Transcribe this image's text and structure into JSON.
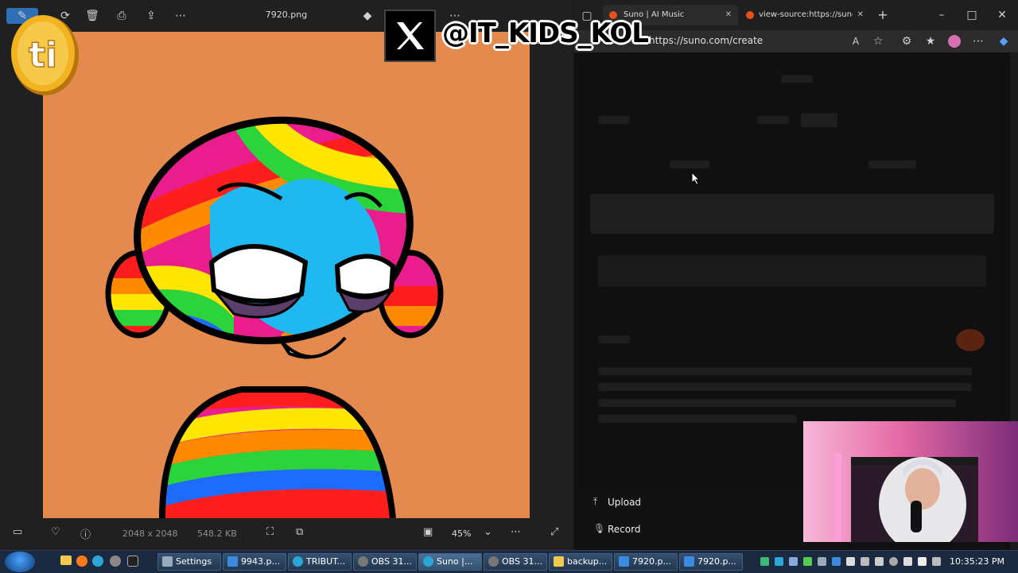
{
  "photos": {
    "title": "7920.png",
    "dimensions": "2048 x 2048",
    "filesize": "548.2 KB",
    "zoom": "45%"
  },
  "browser": {
    "tabs": [
      {
        "label": "Suno | AI Music"
      },
      {
        "label": "view-source:https://suno.c"
      }
    ],
    "url": "https://suno.com/create",
    "menu": {
      "upload": "Upload",
      "record": "Record"
    }
  },
  "overlay": {
    "handle": "@IT_KIDS_KOL",
    "coin_text": "ti"
  },
  "taskbar": {
    "items": [
      {
        "label": "Settings"
      },
      {
        "label": "9943.p..."
      },
      {
        "label": "TRIBUT..."
      },
      {
        "label": "OBS 31..."
      },
      {
        "label": "Suno |..."
      },
      {
        "label": "OBS 31..."
      },
      {
        "label": "backup..."
      },
      {
        "label": "7920.p..."
      },
      {
        "label": "7920.p..."
      }
    ],
    "clock": "10:35:23 PM"
  },
  "colors": {
    "canvas_bg": "#e58a4f",
    "taskbar": "#1b2a3f",
    "suno_orange": "#e8501a"
  }
}
